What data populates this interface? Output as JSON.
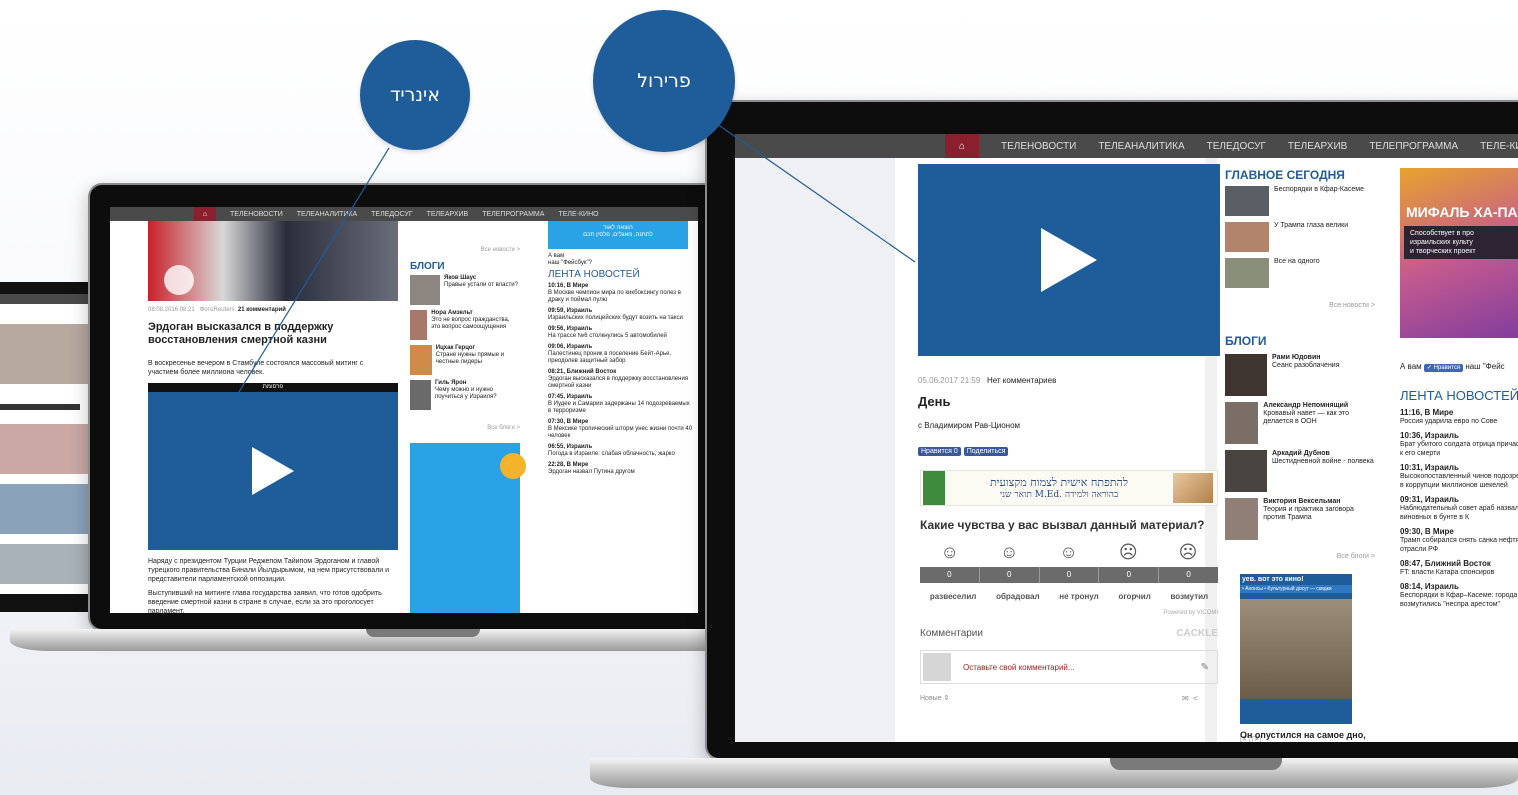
{
  "bubbles": {
    "left_label": "אינריד",
    "right_label": "פרירול"
  },
  "nav_items": [
    "ТЕЛЕНОВОСТИ",
    "ТЕЛЕАНАЛИТИКА",
    "ТЕЛЕДОСУГ",
    "ТЕЛЕАРХИВ",
    "ТЕЛЕПРОГРАММА",
    "ТЕЛЕ-КИНО"
  ],
  "small": {
    "meta_date": "08.08.2016 08:21",
    "meta_source": "ФотоReuters",
    "meta_comments": "21 комментарий",
    "headline": "Эрдоган высказался в поддержку восстановления смертной казни",
    "lead": "В воскресенье вечером в Стамбуле состоялся массовый митинг с участием более миллиона человек.",
    "ad_label": "פרסומת",
    "body1": "Наряду с президентом Турции Реджепом Тайипом Эрдоганом и главой турецкого правительства Бинали Йылдырымом, на нем присутствовали и представители парламентской оппозиции.",
    "body2": "Выступивший на митинге глава государства заявил, что готов одобрить введение смертной казни в стране в случае, если за это проголосует парламент.",
    "all_news": "Все новости >",
    "blogs_title": "БЛОГИ",
    "blogs": [
      {
        "name": "Яков Шаус",
        "text": "Правые устали от власти?"
      },
      {
        "name": "Нора Амзельт",
        "text": "Это не вопрос гражданства, это вопрос самоощущения"
      },
      {
        "name": "Ицхак Герцог",
        "text": "Стране нужны прямые и честные лидеры"
      },
      {
        "name": "Гиль Ярон",
        "text": "Чему можно и нужно поучиться у Израиля?"
      }
    ],
    "all_blogs": "Все блоги >",
    "promo_text": "הוצאה לאור",
    "promo_sub": "לתחנה, מאגלים, פלסין תכם",
    "fb_q1": "А вам",
    "fb_q2": "наш \"Фейсбук\"?",
    "lenta_title": "ЛЕНТА НОВОСТЕЙ",
    "lenta": [
      {
        "time": "10:16, В Мире",
        "text": "В Москве чемпион мира по кикбоксингу полез в драку и поймал пулю"
      },
      {
        "time": "09:59, Израиль",
        "text": "Израильских полицейских будут возить на такси"
      },
      {
        "time": "09:56, Израиль",
        "text": "На трассе №6 столкнулись 5 автомобилей"
      },
      {
        "time": "09:06, Израиль",
        "text": "Палестинец проник в поселение Бейт-Арье, преодолев защитный забор"
      },
      {
        "time": "08:21, Ближний Восток",
        "text": "Эрдоган высказался в поддержку восстановления смертной казни"
      },
      {
        "time": "07:45, Израиль",
        "text": "В Иудее и Самарии задержаны 14 подозреваемых в терроризме"
      },
      {
        "time": "07:30, В Мире",
        "text": "В Мексике тропический шторм унес жизни почти 40 человек"
      },
      {
        "time": "06:55, Израиль",
        "text": "Погода в Израиле: слабая облачность, жарко"
      },
      {
        "time": "22:28, В Мире",
        "text": "Эрдоган назвал Путина другом"
      }
    ]
  },
  "big": {
    "meta_date": "05.06.2017 21:59",
    "meta_comments": "Нет комментариев",
    "title": "День",
    "author": "с Владимиром Рав-Ционом",
    "like_label": "Нравится 0",
    "share_label": "Поделиться",
    "banner_main": "להתפתח אישית לצמוח מקצועית",
    "banner_sub": "תואר שני M.Ed. בהוראה ולמידה",
    "poll_q": "Какие чувства у вас вызвал данный материал?",
    "poll_counts": [
      "0",
      "0",
      "0",
      "0",
      "0"
    ],
    "poll_labels": [
      "развеселил",
      "обрадовал",
      "не тронул",
      "огорчил",
      "возмутил"
    ],
    "powered": "Powered by VICOMI",
    "comments_title": "Комментарии",
    "cackle": "CACKLE",
    "comment_placeholder": "Оставьте свой комментарий...",
    "sort_label": "Новые ⇕",
    "glavnoe_title": "ГЛАВНОЕ СЕГОДНЯ",
    "glavnoe": [
      "Беспорядки в Кфар-Касеме",
      "У Трампа глаза велики",
      "Все на одного"
    ],
    "all_news": "Все новости >",
    "blogs_title": "БЛОГИ",
    "blogs": [
      {
        "name": "Рами Юдовин",
        "text": "Сеанс разоблачения"
      },
      {
        "name": "Александр Непомнящий",
        "text": "Кровавый навет — как это делается в ООН"
      },
      {
        "name": "Аркадий Дубнов",
        "text": "Шестидневной войне - полвека"
      },
      {
        "name": "Виктория Вексельман",
        "text": "Теория и практика заговора против Трампа"
      }
    ],
    "all_blogs": "Все блоги >",
    "cinema_head": "уев. вот это кино!",
    "cinema_tabs": "• Анонсы • Культурный досуг — скидки",
    "cinema_caption": "Он опустился на самое дно,",
    "ad_title": "МИФАЛЬ ХА-ПАЙ",
    "ad_text1": "Способствует в про",
    "ad_text2": "израильских культу",
    "ad_text3": "и творческих проект",
    "fb_q1": "А вам",
    "fb_btn": "✓ Нравится",
    "fb_q2": "наш \"Фейс",
    "lenta_title": "ЛЕНТА НОВОСТЕЙ",
    "lenta": [
      {
        "time": "11:16, В Мире",
        "text": "Россия ударила евро по Сове"
      },
      {
        "time": "10:36, Израиль",
        "text": "Брат убитого солдата отрица причастность к его смерти"
      },
      {
        "time": "10:31, Израиль",
        "text": "Высокопоставленный чинов подозревается в коррупции миллионов шекелей"
      },
      {
        "time": "09:31, Израиль",
        "text": "Наблюдательный совет араб назвал виновных в бунте в К"
      },
      {
        "time": "09:30, В Мире",
        "text": "Трамп собирался снять санка нефтяной отрасли РФ"
      },
      {
        "time": "08:47, Ближний Восток",
        "text": "FT: власти Катара спонсиров"
      },
      {
        "time": "08:14, Израиль",
        "text": "Беспорядки в Кфар–Касеме: города возмутились \"неспра арестом\""
      }
    ]
  },
  "colors": {
    "brand_blue": "#1f5c9a",
    "nav": "#4a4a4a",
    "home": "#8a1f2d"
  }
}
